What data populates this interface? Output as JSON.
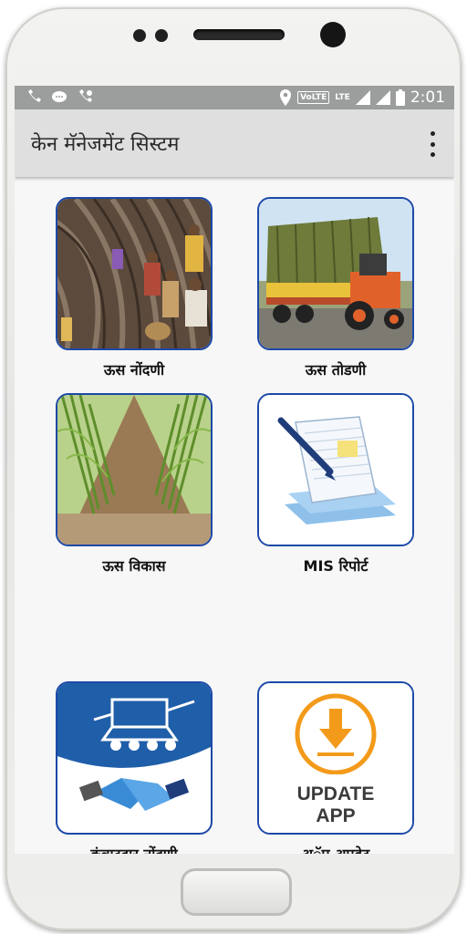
{
  "statusbar": {
    "volte": "VoLTE",
    "lte": "LTE",
    "time": "2:01"
  },
  "appbar": {
    "title": "केन मॅनेजमेंट सिस्टम"
  },
  "tiles": [
    {
      "label": "ऊस नोंदणी"
    },
    {
      "label": "ऊस तोडणी"
    },
    {
      "label": "ऊस विकास"
    },
    {
      "label": "MIS रिपोर्ट"
    },
    {
      "label": "कंत्राटदार नोंदणी"
    },
    {
      "label": "अॅप अपडेट",
      "button_text_1": "UPDATE",
      "button_text_2": "APP"
    }
  ],
  "colors": {
    "tile_border": "#1d49a8",
    "appbar": "#dedfde",
    "statusbar": "#9b9e9c",
    "update_accent": "#f39a1b"
  }
}
